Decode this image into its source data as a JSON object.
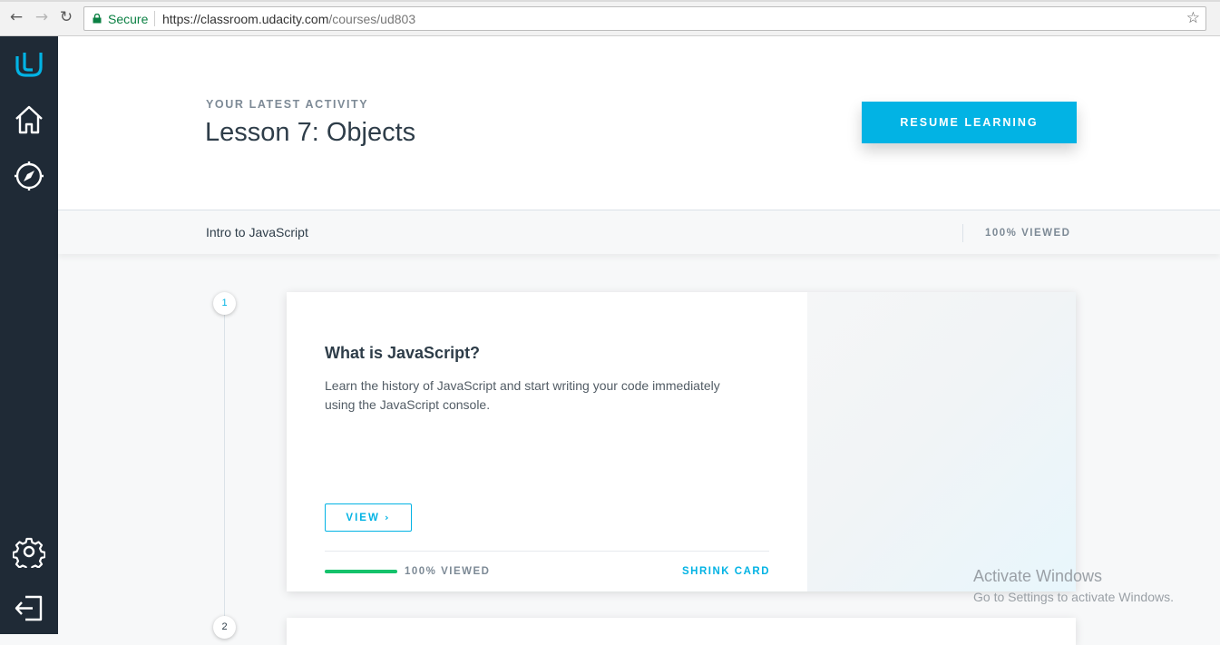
{
  "browser": {
    "secure_label": "Secure",
    "url_host": "https://classroom.udacity.com",
    "url_path": "/courses/ud803"
  },
  "sidebar": {
    "items": [
      {
        "icon": "udacity-logo-icon"
      },
      {
        "icon": "home-icon"
      },
      {
        "icon": "compass-icon"
      },
      {
        "icon": "gear-icon"
      },
      {
        "icon": "logout-icon"
      }
    ],
    "accent": "#02b3e4",
    "background": "#1f2a36"
  },
  "header": {
    "kicker": "YOUR LATEST ACTIVITY",
    "lesson_title": "Lesson 7: Objects",
    "resume_label": "RESUME LEARNING"
  },
  "course": {
    "name": "Intro to JavaScript",
    "viewed": "100% VIEWED"
  },
  "timeline": {
    "nodes": [
      "1",
      "2"
    ]
  },
  "card": {
    "title": "What is JavaScript?",
    "description": "Learn the history of JavaScript and start writing your code immediately using the JavaScript console.",
    "view_label": "VIEW",
    "progress_fraction": 1.0,
    "viewed": "100% VIEWED",
    "shrink_label": "SHRINK CARD"
  },
  "watermark": {
    "line1": "Activate Windows",
    "line2": "Go to Settings to activate Windows."
  },
  "colors": {
    "accent": "#02b3e4",
    "progress": "#15c26b",
    "text_dark": "#2e3d49"
  }
}
